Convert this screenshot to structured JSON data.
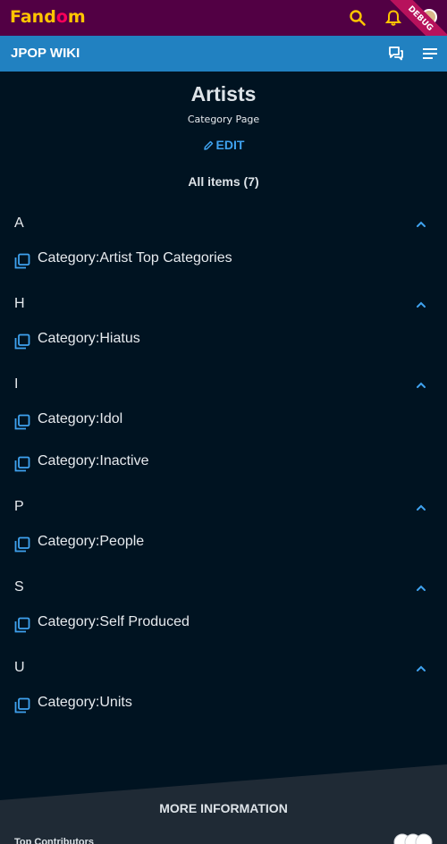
{
  "brand": {
    "logo": "Fandom",
    "debug_label": "DEBUG"
  },
  "wiki": {
    "name": "JPOP WIKI"
  },
  "page": {
    "title": "Artists",
    "subtitle": "Category Page",
    "edit_label": "EDIT",
    "all_items_label": "All items (7)"
  },
  "sections": [
    {
      "letter": "A",
      "items": [
        "Category:Artist Top Categories"
      ]
    },
    {
      "letter": "H",
      "items": [
        "Category:Hiatus"
      ]
    },
    {
      "letter": "I",
      "items": [
        "Category:Idol",
        "Category:Inactive"
      ]
    },
    {
      "letter": "P",
      "items": [
        "Category:People"
      ]
    },
    {
      "letter": "S",
      "items": [
        "Category:Self Produced"
      ]
    },
    {
      "letter": "U",
      "items": [
        "Category:Units"
      ]
    }
  ],
  "footer": {
    "more_info_label": "MORE INFORMATION",
    "top_contributors_label": "Top Contributors"
  },
  "colors": {
    "topbar": "#520044",
    "wikibar": "#2181c1",
    "background": "#001321",
    "accent_link": "#3fa2ef",
    "logo_yellow": "#ffc500",
    "logo_pink": "#fa005a"
  },
  "icons": {
    "top": [
      "search-icon",
      "bell-icon",
      "avatar"
    ],
    "wiki": [
      "discussion-icon",
      "menu-icon"
    ],
    "item": "category-pages-icon",
    "section": "chevron-up-icon"
  }
}
